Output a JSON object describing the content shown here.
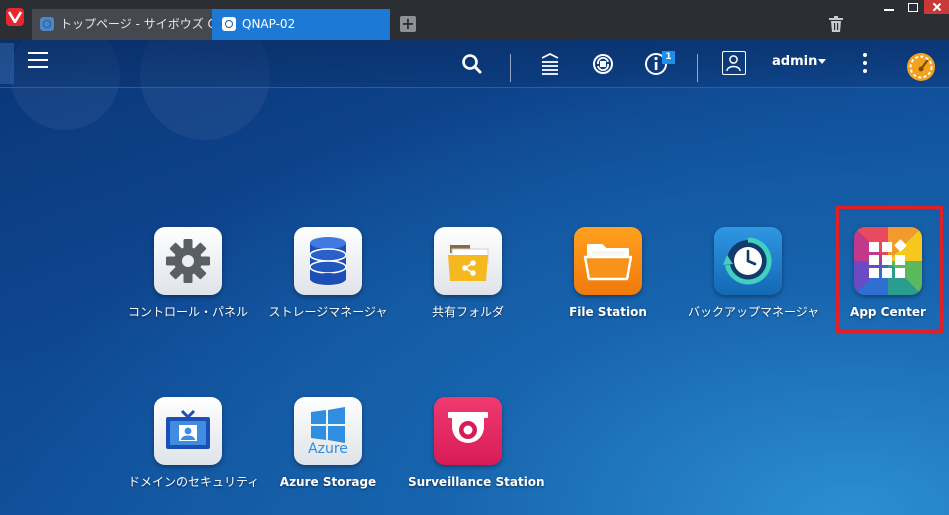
{
  "browser": {
    "tabs": [
      {
        "label": "トップページ - サイボウズ Of"
      },
      {
        "label": "QNAP-02"
      }
    ],
    "new_tab": "+"
  },
  "header": {
    "user": "admin",
    "notification_count": "1"
  },
  "apps": [
    {
      "label": "コントロール・パネル"
    },
    {
      "label": "ストレージマネージャ"
    },
    {
      "label": "共有フォルダ"
    },
    {
      "label": "File Station"
    },
    {
      "label": "バックアップマネージャ"
    },
    {
      "label": "App Center"
    },
    {
      "label": "ドメインのセキュリティ"
    },
    {
      "label": "Azure Storage",
      "tile_text": "Azure"
    },
    {
      "label": "Surveillance Station"
    }
  ],
  "colors": {
    "highlight": "#e01f26",
    "active_tab": "#1d79d6"
  }
}
